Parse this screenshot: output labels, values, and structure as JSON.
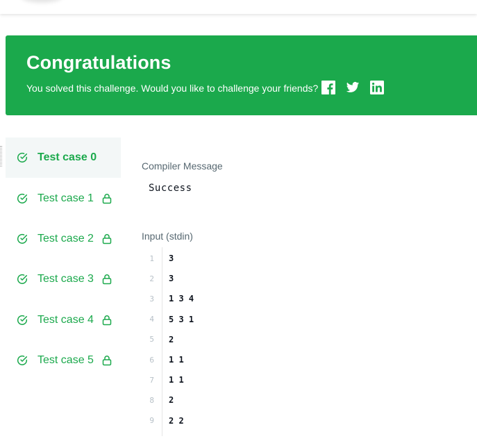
{
  "banner": {
    "title": "Congratulations",
    "subtitle": "You solved this challenge. Would you like to challenge your friends?",
    "share_icons": [
      "facebook-icon",
      "twitter-icon",
      "linkedin-icon"
    ],
    "color": "#1ba94c"
  },
  "test_cases": [
    {
      "label": "Test case 0",
      "passed": true,
      "locked": false,
      "active": true
    },
    {
      "label": "Test case 1",
      "passed": true,
      "locked": true,
      "active": false
    },
    {
      "label": "Test case 2",
      "passed": true,
      "locked": true,
      "active": false
    },
    {
      "label": "Test case 3",
      "passed": true,
      "locked": true,
      "active": false
    },
    {
      "label": "Test case 4",
      "passed": true,
      "locked": true,
      "active": false
    },
    {
      "label": "Test case 5",
      "passed": true,
      "locked": true,
      "active": false
    }
  ],
  "compiler": {
    "label": "Compiler Message",
    "message": "Success"
  },
  "input": {
    "label": "Input (stdin)",
    "lines": [
      {
        "num": "1",
        "text": "3"
      },
      {
        "num": "2",
        "text": "3"
      },
      {
        "num": "3",
        "text": "1 3 4"
      },
      {
        "num": "4",
        "text": "5 3 1"
      },
      {
        "num": "5",
        "text": "2"
      },
      {
        "num": "6",
        "text": "1 1"
      },
      {
        "num": "7",
        "text": "1 1"
      },
      {
        "num": "8",
        "text": "2"
      },
      {
        "num": "9",
        "text": "2 2"
      }
    ]
  },
  "colors": {
    "accent": "#1ba94c",
    "label_gray": "#576871",
    "line_number": "#b7c0c7"
  }
}
